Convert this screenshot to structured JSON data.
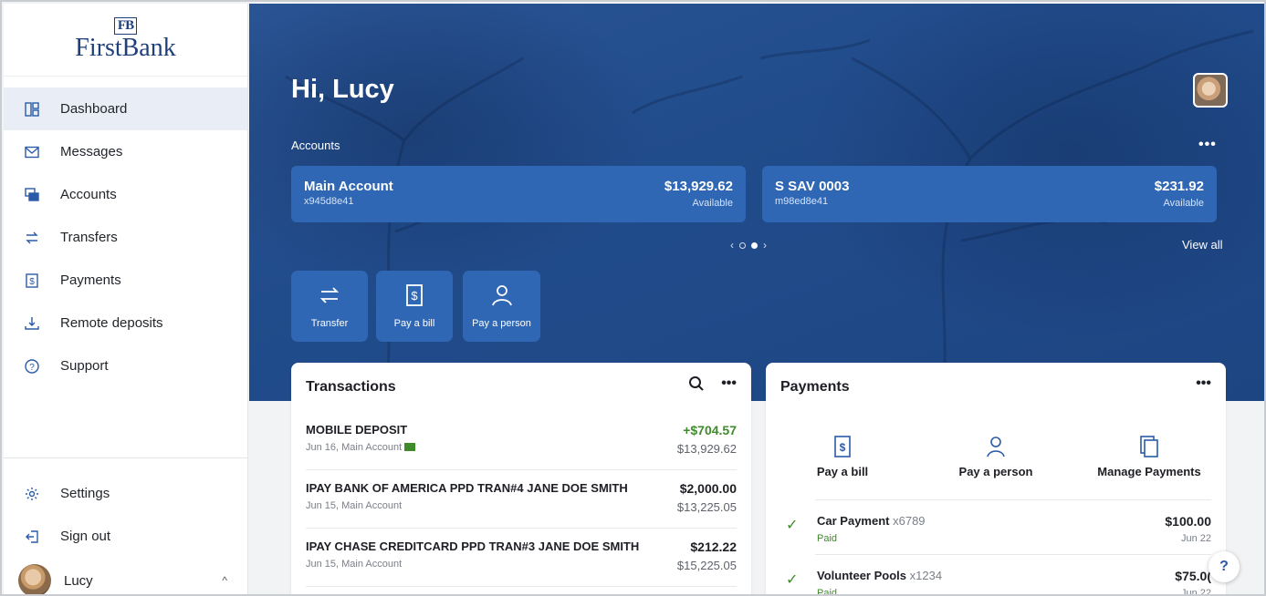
{
  "brand": {
    "monogram": "FB",
    "name": "FirstBank"
  },
  "sidebar": {
    "items": [
      {
        "label": "Dashboard",
        "icon": "dashboard-icon",
        "active": true
      },
      {
        "label": "Messages",
        "icon": "envelope-icon"
      },
      {
        "label": "Accounts",
        "icon": "accounts-icon"
      },
      {
        "label": "Transfers",
        "icon": "transfer-arrows-icon"
      },
      {
        "label": "Payments",
        "icon": "dollar-bill-icon"
      },
      {
        "label": "Remote deposits",
        "icon": "deposit-download-icon"
      },
      {
        "label": "Support",
        "icon": "question-circle-icon"
      }
    ],
    "bottom": [
      {
        "label": "Settings",
        "icon": "gear-icon"
      },
      {
        "label": "Sign out",
        "icon": "sign-out-icon"
      }
    ],
    "user": {
      "name": "Lucy",
      "chevron": "^"
    }
  },
  "hero": {
    "greeting": "Hi, Lucy",
    "accounts_label": "Accounts",
    "more": "•••",
    "view_all": "View all",
    "accounts": [
      {
        "name": "Main Account",
        "id": "x945d8e41",
        "balance": "$13,929.62",
        "available": "Available"
      },
      {
        "name": "S SAV 0003",
        "id": "m98ed8e41",
        "balance": "$231.92",
        "available": "Available"
      }
    ],
    "pager": {
      "prev": "‹",
      "next": "›"
    },
    "quick_actions": [
      {
        "label": "Transfer",
        "icon": "transfer-arrows-icon"
      },
      {
        "label": "Pay a bill",
        "icon": "bill-icon"
      },
      {
        "label": "Pay a person",
        "icon": "person-icon"
      }
    ]
  },
  "transactions": {
    "title": "Transactions",
    "more": "•••",
    "rows": [
      {
        "desc": "MOBILE DEPOSIT",
        "meta": "Jun 16, Main Account",
        "amount": "+$704.57",
        "balance": "$13,929.62",
        "positive": true
      },
      {
        "desc": "IPAY BANK OF AMERICA PPD TRAN#4 JANE DOE SMITH",
        "meta": "Jun 15, Main Account",
        "amount": "$2,000.00",
        "balance": "$13,225.05"
      },
      {
        "desc": "IPAY CHASE CREDITCARD PPD TRAN#3 JANE DOE SMITH",
        "meta": "Jun 15, Main Account",
        "amount": "$212.22",
        "balance": "$15,225.05"
      }
    ]
  },
  "payments": {
    "title": "Payments",
    "more": "•••",
    "actions": [
      {
        "label": "Pay a bill",
        "icon": "bill-icon"
      },
      {
        "label": "Pay a person",
        "icon": "person-icon"
      },
      {
        "label": "Manage Payments",
        "icon": "manage-payments-icon"
      }
    ],
    "rows": [
      {
        "name": "Car Payment",
        "acct": "x6789",
        "status": "Paid",
        "amount": "$100.00",
        "date": "Jun 22"
      },
      {
        "name": "Volunteer Pools",
        "acct": "x1234",
        "status": "Paid",
        "amount": "$75.0(",
        "date": "Jun 22"
      }
    ]
  },
  "help": "?",
  "colors": {
    "brand": "#1f3f7a",
    "hero": "#214c8b",
    "card_blue": "#2f67b4",
    "positive": "#3f8a2a"
  }
}
